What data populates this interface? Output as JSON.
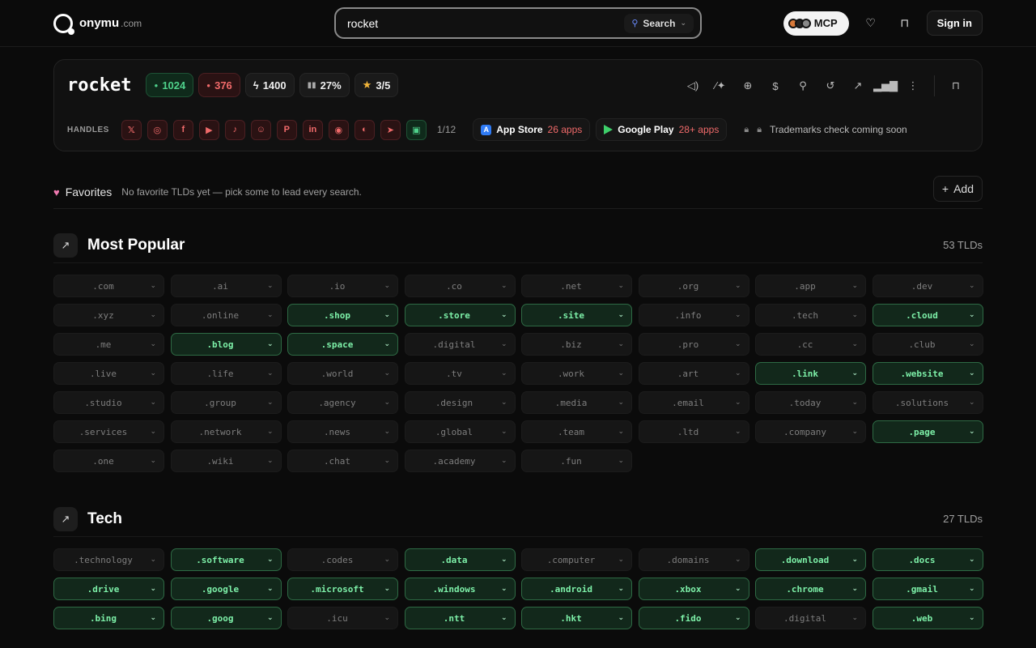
{
  "brand": {
    "name": "onymu",
    "tld": ".com"
  },
  "search": {
    "value": "rocket",
    "mode_label": "Search"
  },
  "nav": {
    "mcp_label": "MCP",
    "signin_label": "Sign in"
  },
  "card": {
    "domain": "rocket",
    "stats": {
      "green": "1024",
      "red": "376",
      "bolt": "1400",
      "percent": "27%",
      "stars": "3/5"
    },
    "handles_label": "HANDLES",
    "handles": [
      {
        "name": "x-icon",
        "glyph": "𝕏",
        "available": false
      },
      {
        "name": "instagram-icon",
        "glyph": "◎",
        "available": false
      },
      {
        "name": "facebook-icon",
        "glyph": "f",
        "available": false
      },
      {
        "name": "youtube-icon",
        "glyph": "▶",
        "available": false
      },
      {
        "name": "tiktok-icon",
        "glyph": "♪",
        "available": false
      },
      {
        "name": "snapchat-icon",
        "glyph": "☺",
        "available": false
      },
      {
        "name": "pinterest-icon",
        "glyph": "P",
        "available": false
      },
      {
        "name": "linkedin-icon",
        "glyph": "in",
        "available": false
      },
      {
        "name": "discord-icon",
        "glyph": "◉",
        "available": false
      },
      {
        "name": "github-icon",
        "glyph": "◐",
        "available": false
      },
      {
        "name": "telegram-icon",
        "glyph": "➤",
        "available": false
      },
      {
        "name": "twitch-icon",
        "glyph": "▣",
        "available": true
      }
    ],
    "handles_count": "1/12",
    "app_store": {
      "label": "App Store",
      "count": "26 apps"
    },
    "google_play": {
      "label": "Google Play",
      "count": "28+ apps"
    },
    "trademark": "Trademarks check coming soon"
  },
  "favorites": {
    "title": "Favorites",
    "empty": "No favorite TLDs yet — pick some to lead every search.",
    "add_label": "Add"
  },
  "sections": [
    {
      "title": "Most Popular",
      "count": "53 TLDs",
      "tlds": [
        {
          "tld": ".com",
          "available": false
        },
        {
          "tld": ".ai",
          "available": false
        },
        {
          "tld": ".io",
          "available": false
        },
        {
          "tld": ".co",
          "available": false
        },
        {
          "tld": ".net",
          "available": false
        },
        {
          "tld": ".org",
          "available": false
        },
        {
          "tld": ".app",
          "available": false
        },
        {
          "tld": ".dev",
          "available": false
        },
        {
          "tld": ".xyz",
          "available": false
        },
        {
          "tld": ".online",
          "available": false
        },
        {
          "tld": ".shop",
          "available": true
        },
        {
          "tld": ".store",
          "available": true
        },
        {
          "tld": ".site",
          "available": true
        },
        {
          "tld": ".info",
          "available": false
        },
        {
          "tld": ".tech",
          "available": false
        },
        {
          "tld": ".cloud",
          "available": true
        },
        {
          "tld": ".me",
          "available": false
        },
        {
          "tld": ".blog",
          "available": true
        },
        {
          "tld": ".space",
          "available": true
        },
        {
          "tld": ".digital",
          "available": false
        },
        {
          "tld": ".biz",
          "available": false
        },
        {
          "tld": ".pro",
          "available": false
        },
        {
          "tld": ".cc",
          "available": false
        },
        {
          "tld": ".club",
          "available": false
        },
        {
          "tld": ".live",
          "available": false
        },
        {
          "tld": ".life",
          "available": false
        },
        {
          "tld": ".world",
          "available": false
        },
        {
          "tld": ".tv",
          "available": false
        },
        {
          "tld": ".work",
          "available": false
        },
        {
          "tld": ".art",
          "available": false
        },
        {
          "tld": ".link",
          "available": true
        },
        {
          "tld": ".website",
          "available": true
        },
        {
          "tld": ".studio",
          "available": false
        },
        {
          "tld": ".group",
          "available": false
        },
        {
          "tld": ".agency",
          "available": false
        },
        {
          "tld": ".design",
          "available": false
        },
        {
          "tld": ".media",
          "available": false
        },
        {
          "tld": ".email",
          "available": false
        },
        {
          "tld": ".today",
          "available": false
        },
        {
          "tld": ".solutions",
          "available": false
        },
        {
          "tld": ".services",
          "available": false
        },
        {
          "tld": ".network",
          "available": false
        },
        {
          "tld": ".news",
          "available": false
        },
        {
          "tld": ".global",
          "available": false
        },
        {
          "tld": ".team",
          "available": false
        },
        {
          "tld": ".ltd",
          "available": false
        },
        {
          "tld": ".company",
          "available": false
        },
        {
          "tld": ".page",
          "available": true
        },
        {
          "tld": ".one",
          "available": false
        },
        {
          "tld": ".wiki",
          "available": false
        },
        {
          "tld": ".chat",
          "available": false
        },
        {
          "tld": ".academy",
          "available": false
        },
        {
          "tld": ".fun",
          "available": false
        }
      ]
    },
    {
      "title": "Tech",
      "count": "27 TLDs",
      "tlds": [
        {
          "tld": ".technology",
          "available": false
        },
        {
          "tld": ".software",
          "available": true
        },
        {
          "tld": ".codes",
          "available": false
        },
        {
          "tld": ".data",
          "available": true
        },
        {
          "tld": ".computer",
          "available": false
        },
        {
          "tld": ".domains",
          "available": false
        },
        {
          "tld": ".download",
          "available": true
        },
        {
          "tld": ".docs",
          "available": true
        },
        {
          "tld": ".drive",
          "available": true
        },
        {
          "tld": ".google",
          "available": true
        },
        {
          "tld": ".microsoft",
          "available": true
        },
        {
          "tld": ".windows",
          "available": true
        },
        {
          "tld": ".android",
          "available": true
        },
        {
          "tld": ".xbox",
          "available": true
        },
        {
          "tld": ".chrome",
          "available": true
        },
        {
          "tld": ".gmail",
          "available": true
        },
        {
          "tld": ".bing",
          "available": true
        },
        {
          "tld": ".goog",
          "available": true
        },
        {
          "tld": ".icu",
          "available": false
        },
        {
          "tld": ".ntt",
          "available": true
        },
        {
          "tld": ".hkt",
          "available": true
        },
        {
          "tld": ".fido",
          "available": true
        },
        {
          "tld": ".digital",
          "available": false
        },
        {
          "tld": ".web",
          "available": true
        }
      ]
    }
  ]
}
